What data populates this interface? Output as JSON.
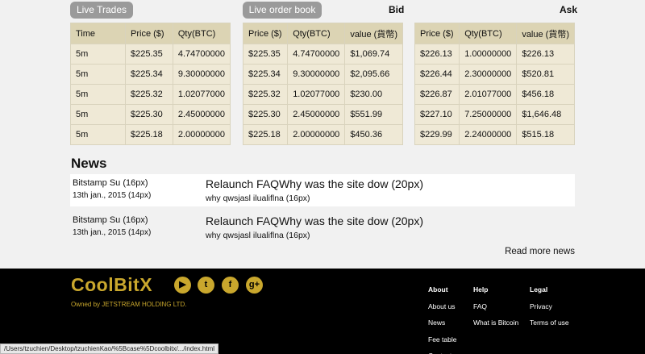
{
  "buttons": {
    "live_trades": "Live Trades",
    "live_order_book": "Live order book"
  },
  "labels": {
    "bid": "Bid",
    "ask": "Ask"
  },
  "trades": {
    "headers": [
      "Time",
      "Price ($)",
      "Qty(BTC)"
    ],
    "rows": [
      [
        "5m",
        "$225.35",
        "4.74700000"
      ],
      [
        "5m",
        "$225.34",
        "9.30000000"
      ],
      [
        "5m",
        "$225.32",
        "1.02077000"
      ],
      [
        "5m",
        "$225.30",
        "2.45000000"
      ],
      [
        "5m",
        "$225.18",
        "2.00000000"
      ]
    ]
  },
  "bid": {
    "headers": [
      "Price ($)",
      "Qty(BTC)",
      "value (貨幣)"
    ],
    "rows": [
      [
        "$225.35",
        "4.74700000",
        "$1,069.74"
      ],
      [
        "$225.34",
        "9.30000000",
        "$2,095.66"
      ],
      [
        "$225.32",
        "1.02077000",
        "$230.00"
      ],
      [
        "$225.30",
        "2.45000000",
        "$551.99"
      ],
      [
        "$225.18",
        "2.00000000",
        "$450.36"
      ]
    ]
  },
  "ask": {
    "headers": [
      "Price ($)",
      "Qty(BTC)",
      "value (貨幣)"
    ],
    "rows": [
      [
        "$226.13",
        "1.00000000",
        "$226.13"
      ],
      [
        "$226.44",
        "2.30000000",
        "$520.81"
      ],
      [
        "$226.87",
        "2.01077000",
        "$456.18"
      ],
      [
        "$227.10",
        "7.25000000",
        "$1,646.48"
      ],
      [
        "$229.99",
        "2.24000000",
        "$515.18"
      ]
    ]
  },
  "news": {
    "title": "News",
    "items": [
      {
        "source": "Bitstamp Su (16px)",
        "date": "13th jan., 2015 (14px)",
        "headline": "Relaunch FAQWhy was the site dow (20px)",
        "summary": "why qwsjasl ilualiflna (16px)"
      },
      {
        "source": "Bitstamp Su (16px)",
        "date": "13th jan., 2015 (14px)",
        "headline": "Relaunch FAQWhy was the site dow (20px)",
        "summary": "why qwsjasl ilualiflna (16px)"
      }
    ],
    "read_more": "Read more news"
  },
  "footer": {
    "logo": "CoolBitX",
    "owned_by": "Owned by JETSTREAM HOLDING LTD.",
    "social": [
      {
        "icon": "youtube-icon",
        "glyph": "▶"
      },
      {
        "icon": "twitter-icon",
        "glyph": "t"
      },
      {
        "icon": "facebook-icon",
        "glyph": "f"
      },
      {
        "icon": "google-plus-icon",
        "glyph": "g+"
      }
    ],
    "about": {
      "title": "About",
      "links": [
        "About us",
        "News",
        "Fee table",
        "Contact us"
      ]
    },
    "help": {
      "title": "Help",
      "links": [
        "FAQ",
        "What is Bitcoin"
      ]
    },
    "legal": {
      "title": "Legal",
      "links": [
        "Privacy",
        "Terms of use"
      ]
    },
    "accent": "#c9a72d"
  },
  "statusbar": "/Users/tzuchien/Desktop/tzuchienKao/%5Bcase%5Dcoolbitx/.../index.html"
}
